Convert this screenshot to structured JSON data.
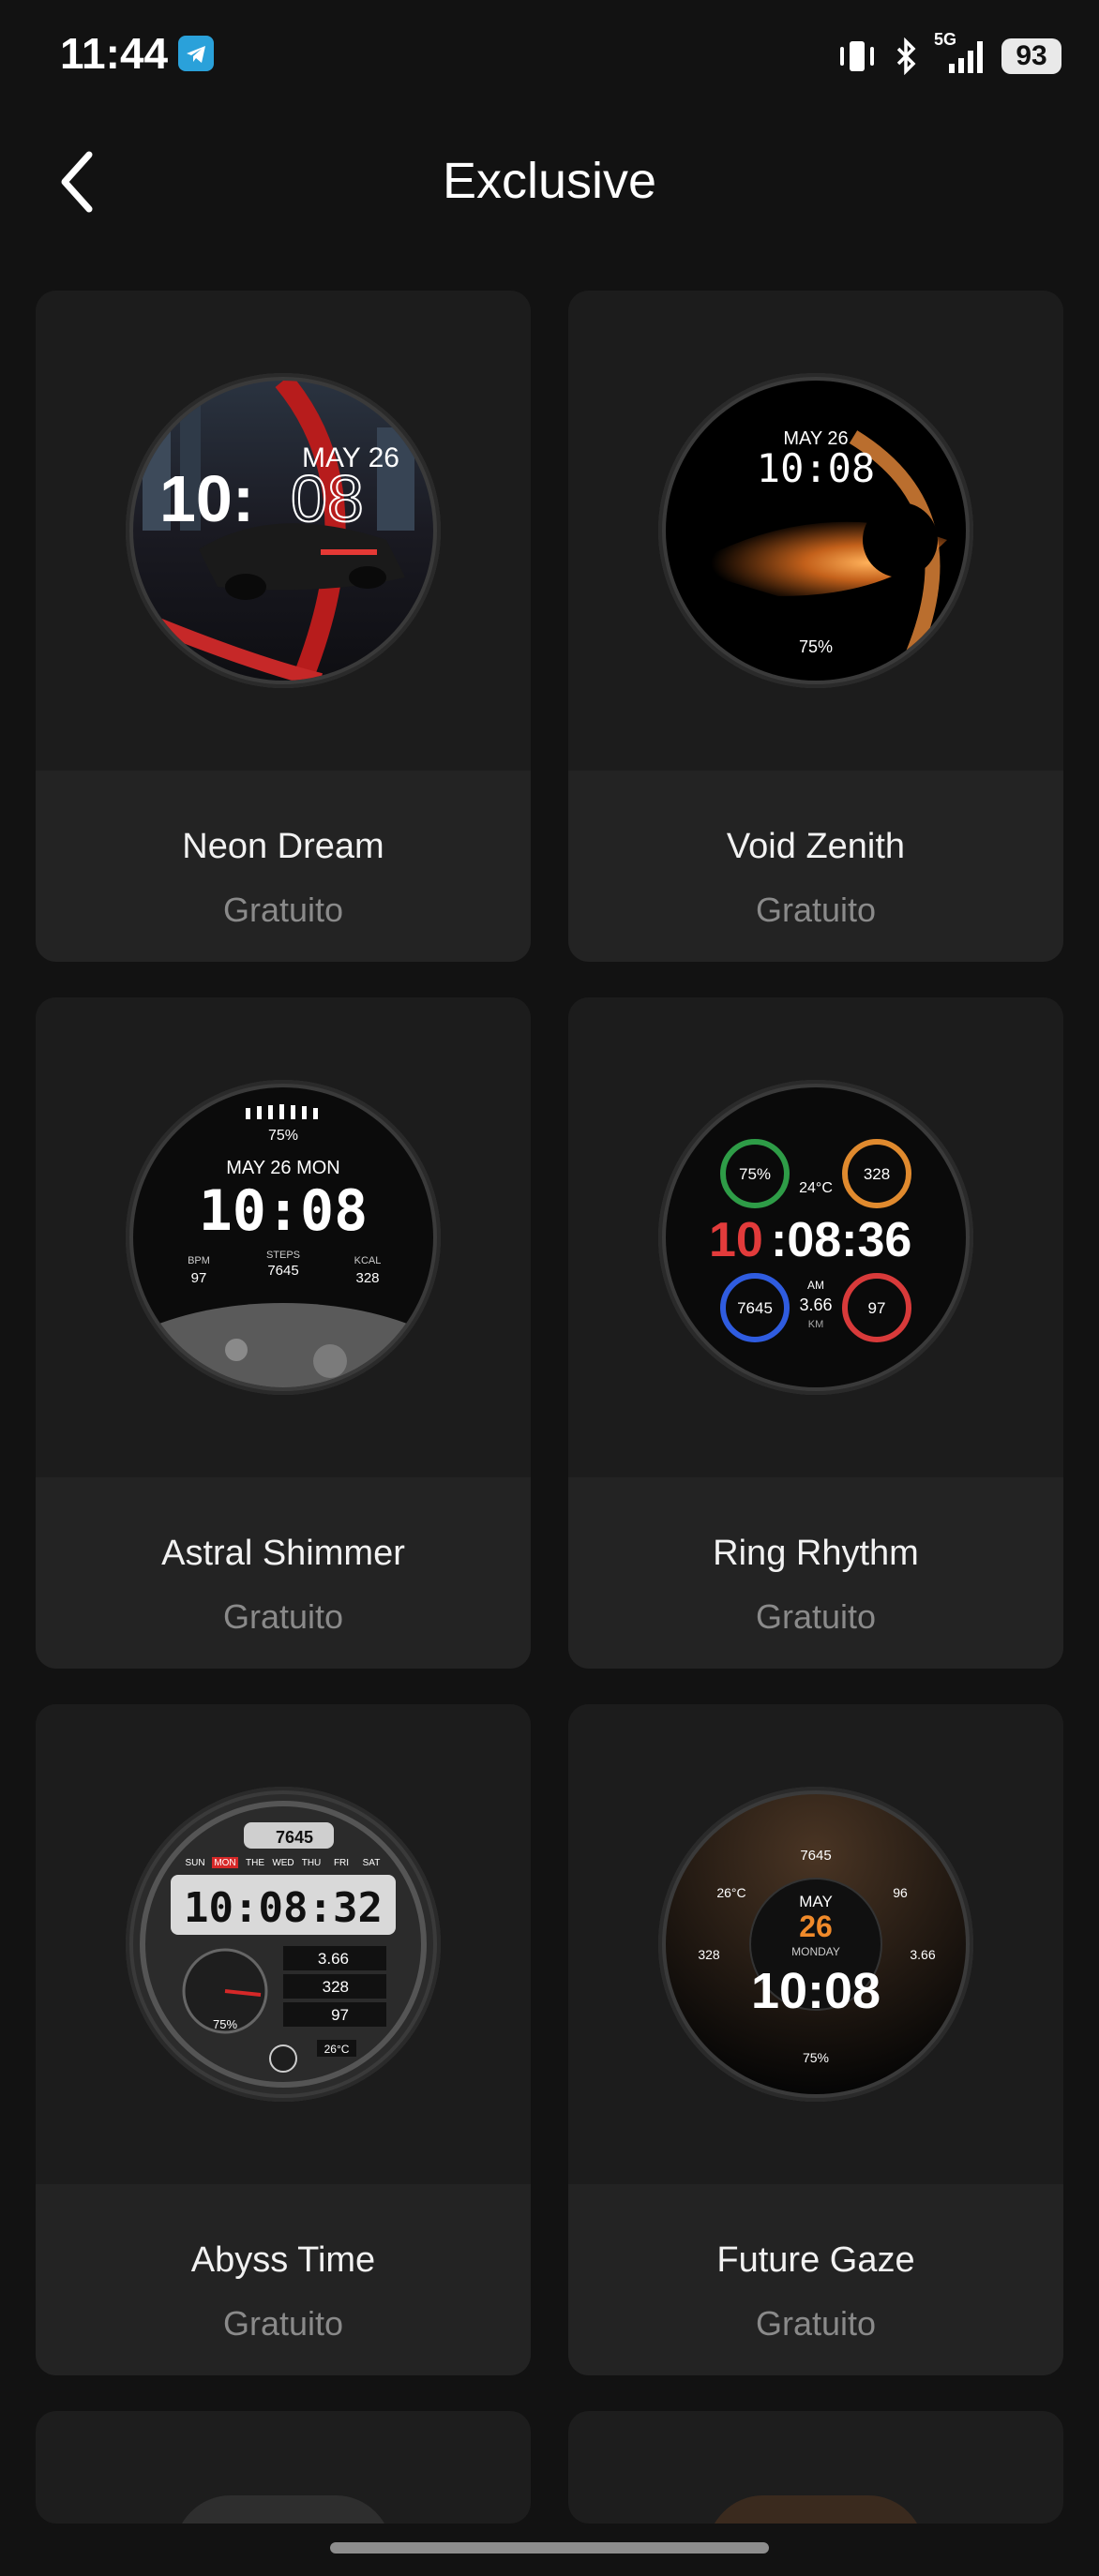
{
  "status_bar": {
    "time": "11:44",
    "network": "5G",
    "battery": "93"
  },
  "header": {
    "title": "Exclusive"
  },
  "cards": [
    {
      "name": "Neon Dream",
      "price": "Gratuito",
      "face": {
        "date": "MAY 26",
        "time_h": "10:",
        "time_m": "08"
      }
    },
    {
      "name": "Void Zenith",
      "price": "Gratuito",
      "face": {
        "date": "MAY 26",
        "time": "10:08",
        "battery": "75%"
      }
    },
    {
      "name": "Astral Shimmer",
      "price": "Gratuito",
      "face": {
        "battery": "75%",
        "date": "MAY 26 MON",
        "time": "10:08",
        "bpm_label": "BPM",
        "bpm": "97",
        "steps_label": "STEPS",
        "steps": "7645",
        "kcal_label": "KCAL",
        "kcal": "328"
      }
    },
    {
      "name": "Ring Rhythm",
      "price": "Gratuito",
      "face": {
        "battery": "75%",
        "temp": "24°C",
        "kcal": "328",
        "time_h": "10",
        "time_rest": ":08:36",
        "steps": "7645",
        "ampm": "AM",
        "distance": "3.66",
        "distance_unit": "KM",
        "heart": "97"
      }
    },
    {
      "name": "Abyss Time",
      "price": "Gratuito",
      "face": {
        "steps": "7645",
        "days": [
          "SUN",
          "MON",
          "THE",
          "WED",
          "THU",
          "FRI",
          "SAT"
        ],
        "time": "10:08:32",
        "distance": "3.66",
        "kcal": "328",
        "heart": "97",
        "battery": "75%",
        "temp": "26°C"
      }
    },
    {
      "name": "Future Gaze",
      "price": "Gratuito",
      "face": {
        "steps": "7645",
        "temp": "26°C",
        "heart": "96",
        "month": "MAY",
        "day": "26",
        "weekday": "MONDAY",
        "kcal": "328",
        "distance": "3.66",
        "time": "10:08",
        "battery": "75%"
      }
    }
  ],
  "colors": {
    "background": "#121212",
    "card": "#1d1d1d",
    "card_footer": "#232323",
    "price_text": "#8a8a8a",
    "accent_red": "#e23b3b",
    "accent_orange": "#f08a2a"
  }
}
